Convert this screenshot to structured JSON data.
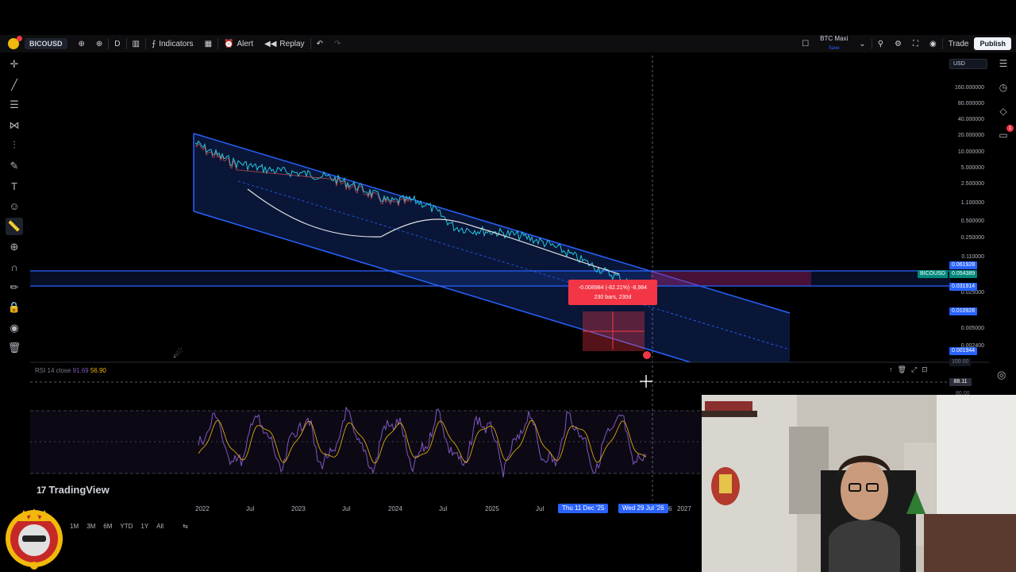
{
  "toolbar": {
    "symbol": "BICOUSD",
    "interval": "D",
    "indicators": "Indicators",
    "alert": "Alert",
    "replay": "Replay",
    "layout_name": "BTC Maxi",
    "layout_status": "Save",
    "trade": "Trade",
    "publish": "Publish"
  },
  "price_scale": {
    "currency": "USD",
    "labels": [
      "160.000000",
      "80.000000",
      "40.000000",
      "20.000000",
      "10.000000",
      "5.000000",
      "2.500000",
      "1.100000",
      "0.500000",
      "0.250000",
      "0.110000",
      "0.025000",
      "0.005000",
      "0.002400"
    ],
    "tag_symbol": "BICOUSD",
    "tag_price_1": "0.061928",
    "tag_price_2": "0.054389",
    "tag_price_3": "0.031914",
    "tag_price_4": "0.010928",
    "tag_price_5": "0.001944",
    "tag_price_6": "100.00"
  },
  "measure": {
    "line1": "-0.008984 (-82.21%) -8,984",
    "line2": "230 bars, 230d"
  },
  "rsi": {
    "title": "RSI 14 close",
    "value1": "91.69",
    "value2": "56.90",
    "current": "88.11",
    "level_80": "80.00"
  },
  "brand": "TradingView",
  "time_axis": {
    "labels": [
      "2022",
      "Jul",
      "2023",
      "Jul",
      "2024",
      "Jul",
      "2025",
      "Jul",
      "2027"
    ],
    "cursor_date_1": "Thu 11 Dec '25",
    "cursor_date_2": "Wed 29 Jul '26",
    "cursor_date_suffix": "6"
  },
  "ranges": [
    "1M",
    "3M",
    "6M",
    "YTD",
    "1Y",
    "All"
  ],
  "colors": {
    "channel_blue": "#2962ff",
    "rsi_purple": "#7e57c2",
    "rsi_yellow": "#f0b90b",
    "measure_red": "#f23645"
  }
}
